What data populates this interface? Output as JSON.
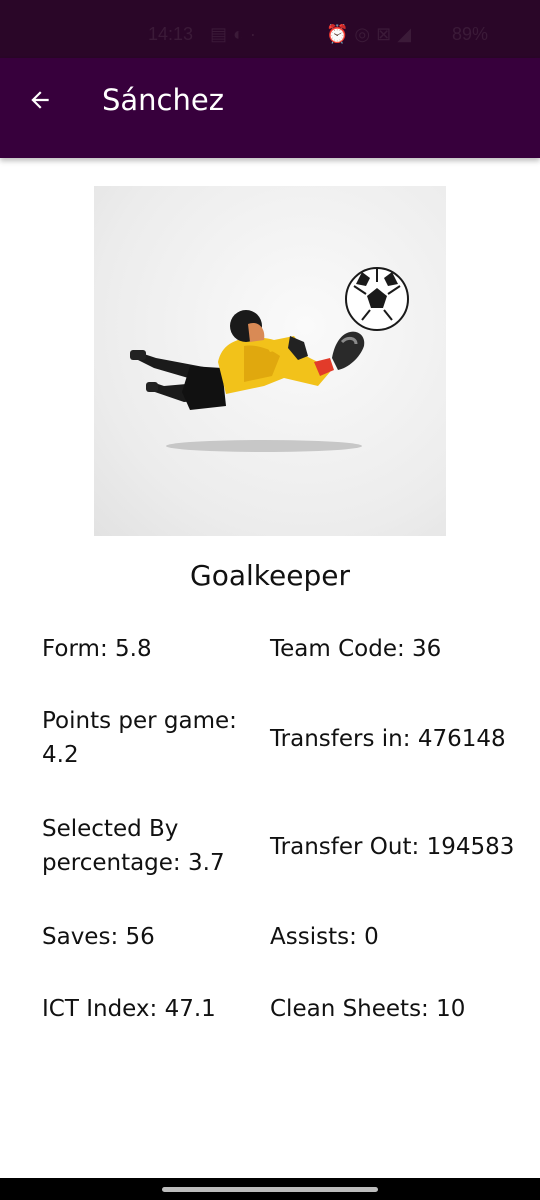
{
  "status_bar": {
    "time": "14:13",
    "battery": "89%",
    "left_icons": [
      "message-icon",
      "data-saver-icon",
      "dot-icon"
    ],
    "right_icons": [
      "alarm-icon",
      "hotspot-icon",
      "vpn-icon",
      "signal-icon"
    ]
  },
  "app_bar": {
    "title": "Sánchez",
    "background": "#37003c",
    "back_icon": "arrow-left-icon"
  },
  "player": {
    "position": "Goalkeeper",
    "image": "goalkeeper-diving-illustration"
  },
  "stats": [
    {
      "label": "Form:",
      "value": "5.8"
    },
    {
      "label": "Team Code:",
      "value": "36"
    },
    {
      "label": "Points per game:",
      "value": "4.2"
    },
    {
      "label": "Transfers in:",
      "value": "476148"
    },
    {
      "label": "Selected By percentage:",
      "value": "3.7"
    },
    {
      "label": "Transfer Out:",
      "value": "194583"
    },
    {
      "label": "Saves:",
      "value": "56"
    },
    {
      "label": "Assists:",
      "value": "0"
    },
    {
      "label": "ICT Index:",
      "value": "47.1"
    },
    {
      "label": "Clean Sheets:",
      "value": "10"
    }
  ]
}
